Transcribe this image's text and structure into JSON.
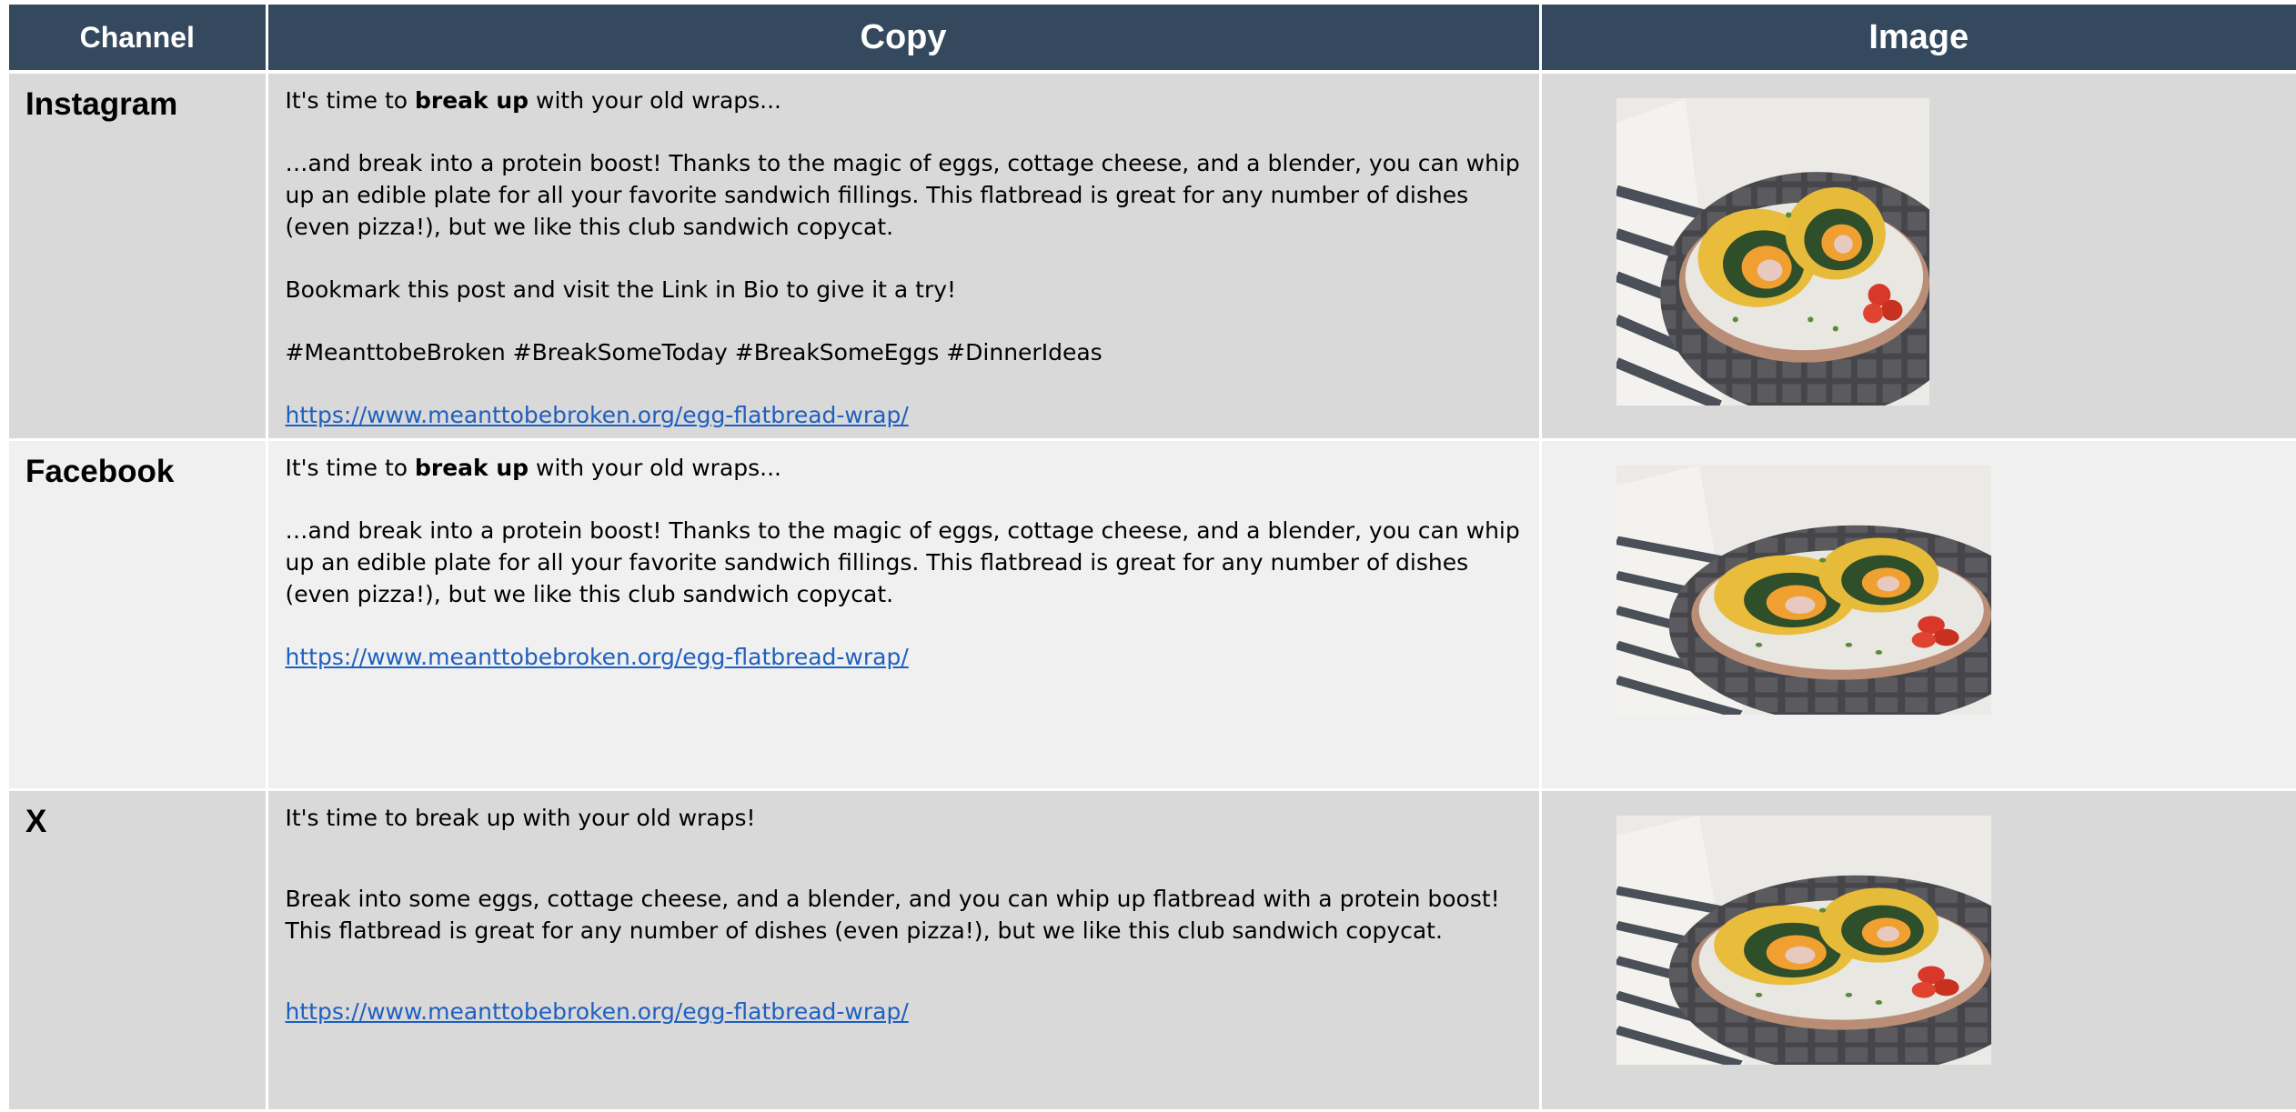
{
  "table": {
    "headers": {
      "channel": "Channel",
      "copy": "Copy",
      "image": "Image"
    },
    "rows": [
      {
        "channel": "Instagram",
        "line1": {
          "pre": "It's time to ",
          "bold": "break up",
          "post": " with your old wraps..."
        },
        "body": "…and break into a protein boost! Thanks to the magic of eggs, cottage cheese, and a blender, you can whip up an  edible plate for all your favorite sandwich fillings. This flatbread is great for any number of dishes (even pizza!), but we like this club sandwich copycat.",
        "cta": "Bookmark this post and visit the Link in Bio to give it a try!",
        "hashtags": "#MeanttobeBroken #BreakSomeToday #BreakSomeEggs #DinnerIdeas",
        "link": "https://www.meanttobebroken.org/egg-flatbread-wrap/",
        "image": "egg-flatbread-wrap-photo"
      },
      {
        "channel": "Facebook",
        "line1": {
          "pre": "It's time to ",
          "bold": "break up",
          "post": " with your old wraps..."
        },
        "body": "…and break into a protein boost! Thanks to the magic of eggs, cottage cheese, and a blender, you can whip up an  edible plate for all your favorite sandwich fillings. This flatbread is great for any number of dishes (even pizza!), but we like this club sandwich copycat.",
        "link": "https://www.meanttobebroken.org/egg-flatbread-wrap/",
        "image": "egg-flatbread-wrap-photo"
      },
      {
        "channel": "X",
        "line1": "It's time to break up with your old wraps!",
        "body": "Break into some eggs, cottage cheese, and a blender, and you can whip up flatbread with a protein boost! This flatbread is great for any number of dishes (even pizza!), but we like this club sandwich copycat.",
        "link": "https://www.meanttobebroken.org/egg-flatbread-wrap/",
        "image": "egg-flatbread-wrap-photo"
      }
    ]
  },
  "colors": {
    "header_bg": "#34495e",
    "row_dark": "#d9d9d9",
    "row_light": "#f0f0f0",
    "link": "#1f5fbf"
  }
}
